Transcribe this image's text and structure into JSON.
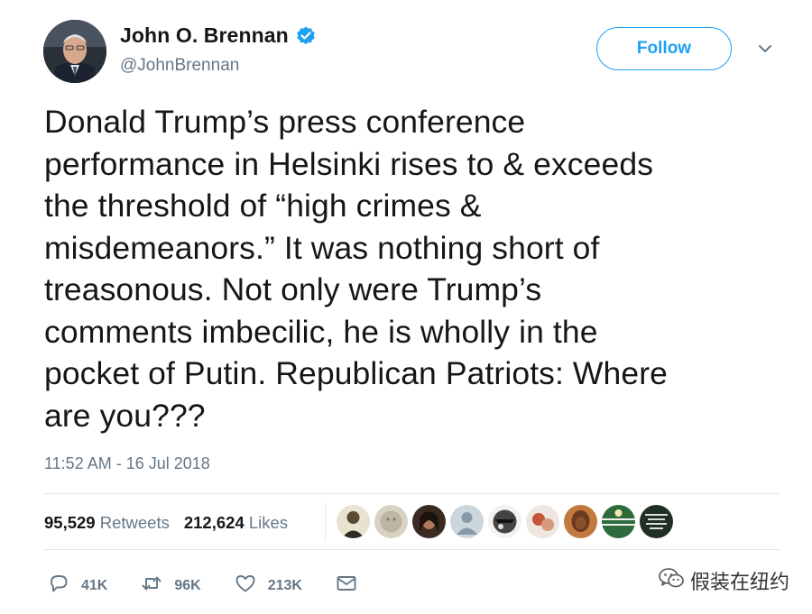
{
  "user": {
    "display_name": "John O. Brennan",
    "handle": "@JohnBrennan",
    "verified": true
  },
  "follow_label": "Follow",
  "tweet": {
    "lines": [
      "Donald Trump’s press conference",
      "performance in Helsinki rises to & exceeds",
      "the threshold of “high crimes &",
      "misdemeanors.” It was nothing short of",
      "treasonous. Not only were Trump’s",
      "comments imbecilic, he is wholly in the",
      "pocket of Putin. Republican Patriots: Where",
      "are you???"
    ],
    "timestamp": "11:52 AM - 16 Jul 2018"
  },
  "stats": {
    "retweets_count": "95,529",
    "retweets_label": "Retweets",
    "likes_count": "212,624",
    "likes_label": "Likes"
  },
  "likers": [
    {
      "icon": "liker-avatar-1",
      "color": "#5a4a2e"
    },
    {
      "icon": "liker-avatar-2",
      "color": "#d8d2c4"
    },
    {
      "icon": "liker-avatar-3",
      "color": "#3a2a22"
    },
    {
      "icon": "liker-avatar-default",
      "color": "#ccd6dd"
    },
    {
      "icon": "liker-avatar-5",
      "color": "#444444"
    },
    {
      "icon": "liker-avatar-6",
      "color": "#c4543a"
    },
    {
      "icon": "liker-avatar-7",
      "color": "#c1793e"
    },
    {
      "icon": "liker-avatar-8",
      "color": "#2e6b3c"
    },
    {
      "icon": "liker-avatar-9",
      "color": "#1f2f24"
    }
  ],
  "actions": {
    "reply_count": "41K",
    "retweet_count": "96K",
    "like_count": "213K"
  },
  "watermark": {
    "text": "假装在纽约"
  },
  "colors": {
    "accent": "#1da1f2",
    "text": "#14171a",
    "muted": "#657786",
    "divider": "#e1e8ed"
  }
}
